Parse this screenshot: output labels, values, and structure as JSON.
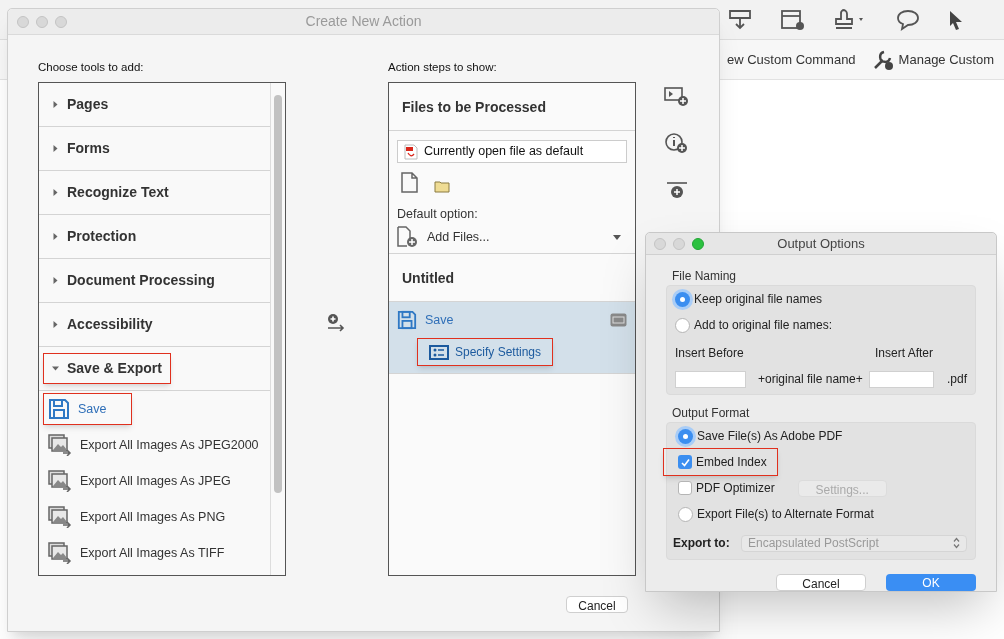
{
  "background": {
    "commands": [
      {
        "label": "ew Custom Command",
        "kind": "plain"
      },
      {
        "label": "Manage Custom",
        "kind": "wrench"
      }
    ]
  },
  "dialog": {
    "title": "Create New Action",
    "tools_label": "Choose tools to add:",
    "tool_groups": [
      {
        "label": "Pages",
        "expanded": false,
        "highlighted": false
      },
      {
        "label": "Forms",
        "expanded": false,
        "highlighted": false
      },
      {
        "label": "Recognize Text",
        "expanded": false,
        "highlighted": false
      },
      {
        "label": "Protection",
        "expanded": false,
        "highlighted": false
      },
      {
        "label": "Document Processing",
        "expanded": false,
        "highlighted": false
      },
      {
        "label": "Accessibility",
        "expanded": false,
        "highlighted": false
      },
      {
        "label": "Save & Export",
        "expanded": true,
        "highlighted": true,
        "children": [
          {
            "label": "Save",
            "kind": "save",
            "selected": true,
            "highlighted": true
          },
          {
            "label": "Export All Images As JPEG2000",
            "kind": "export",
            "selected": false,
            "highlighted": false
          },
          {
            "label": "Export All Images As JPEG",
            "kind": "export",
            "selected": false,
            "highlighted": false
          },
          {
            "label": "Export All Images As PNG",
            "kind": "export",
            "selected": false,
            "highlighted": false
          },
          {
            "label": "Export All Images As TIFF",
            "kind": "export",
            "selected": false,
            "highlighted": false
          }
        ]
      }
    ],
    "steps_label": "Action steps to show:",
    "files_section": {
      "title": "Files to be Processed",
      "file_field": "Currently open file as default",
      "default_option_label": "Default option:",
      "default_option": "Add Files..."
    },
    "action_title": "Untitled",
    "steps": [
      {
        "label": "Save",
        "selected": true,
        "children": [
          {
            "label": "Specify Settings",
            "highlighted": true
          }
        ]
      }
    ],
    "buttons": [
      "Cancel"
    ]
  },
  "output_options": {
    "title": "Output Options",
    "file_naming": {
      "label": "File Naming",
      "options": [
        {
          "label": "Keep original file names",
          "selected": true
        },
        {
          "label": "Add to original file names:",
          "selected": false
        }
      ],
      "insert_before_label": "Insert Before",
      "insert_after_label": "Insert After",
      "middle_text": "+original file name+",
      "suffix": ".pdf"
    },
    "output_format": {
      "label": "Output Format",
      "items": [
        {
          "kind": "radio",
          "label": "Save File(s) As Adobe PDF",
          "selected": true,
          "highlighted": false
        },
        {
          "kind": "checkbox",
          "label": "Embed Index",
          "checked": true,
          "highlighted": true
        },
        {
          "kind": "checkbox",
          "label": "PDF Optimizer",
          "checked": false,
          "highlighted": false,
          "button": "Settings...",
          "button_disabled": true
        },
        {
          "kind": "radio",
          "label": "Export File(s) to Alternate Format",
          "selected": false,
          "highlighted": false
        }
      ],
      "export_to_label": "Export to:",
      "export_to_value": "Encapsulated PostScript",
      "export_disabled": true
    },
    "buttons": [
      {
        "label": "Cancel",
        "primary": false
      },
      {
        "label": "OK",
        "primary": true
      }
    ]
  }
}
